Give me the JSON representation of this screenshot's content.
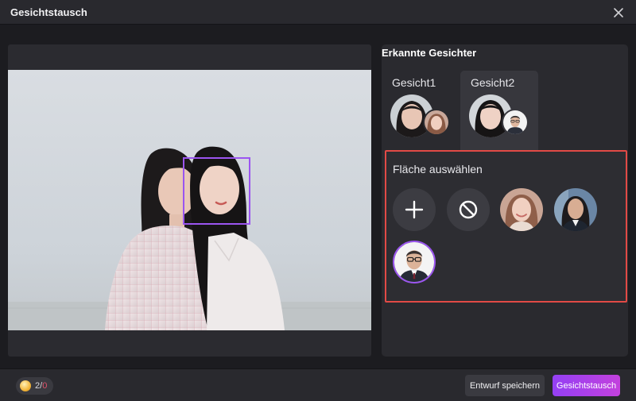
{
  "window": {
    "title": "Gesichtstausch",
    "close_icon": "close-icon"
  },
  "panel": {
    "title": "Erkannte Gesichter",
    "tabs": [
      {
        "label": "Gesicht1",
        "active": false
      },
      {
        "label": "Gesicht2",
        "active": true
      }
    ],
    "select_area": {
      "title": "Fläche auswählen",
      "options": [
        {
          "icon": "plus-icon"
        },
        {
          "icon": "no-entry-icon"
        },
        {
          "icon": "face-thumbnail-woman-smiling"
        },
        {
          "icon": "face-thumbnail-woman-business"
        },
        {
          "icon": "face-thumbnail-man-glasses",
          "selected": true
        }
      ]
    }
  },
  "footer": {
    "credits_used": "2",
    "credits_separator": "/",
    "credits_total": "0",
    "save_draft_label": "Entwurf speichern",
    "swap_label": "Gesichtstausch"
  },
  "colors": {
    "accent_gradient_start": "#9440f4",
    "accent_gradient_end": "#c341dd",
    "highlight_border": "#e24a46",
    "face_box": "#9b55f0"
  }
}
